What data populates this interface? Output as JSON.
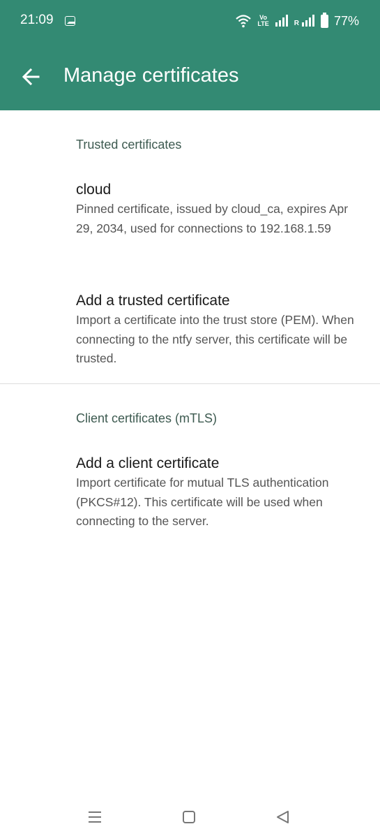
{
  "status_bar": {
    "time": "21:09",
    "battery_pct": "77%",
    "lte_top": "Vo",
    "lte_bottom": "LTE",
    "roaming": "R"
  },
  "app_bar": {
    "title": "Manage certificates",
    "color": "#338a73"
  },
  "sections": {
    "trusted": {
      "header": "Trusted certificates",
      "items": [
        {
          "title": "cloud",
          "summary": "Pinned certificate, issued by cloud_ca, expires Apr 29, 2034, used for connections to 192.168.1.59"
        },
        {
          "title": "Add a trusted certificate",
          "summary": "Import a certificate into the trust store (PEM). When connecting to the ntfy server, this certificate will be trusted."
        }
      ]
    },
    "client": {
      "header": "Client certificates (mTLS)",
      "items": [
        {
          "title": "Add a client certificate",
          "summary": "Import certificate for mutual TLS authentication (PKCS#12). This certificate will be used when connecting to the server."
        }
      ]
    }
  },
  "nav_bar": {
    "buttons": [
      "menu-icon",
      "home-icon",
      "back-triangle-icon"
    ]
  }
}
